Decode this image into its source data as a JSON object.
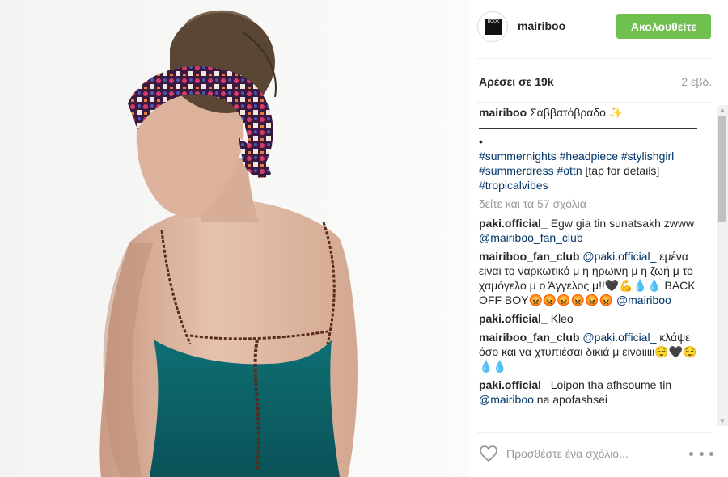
{
  "header": {
    "username": "mairiboo",
    "follow_label": "Ακολουθείτε"
  },
  "meta": {
    "likes": "Αρέσει σε 19k",
    "time": "2 εβδ."
  },
  "caption": {
    "user": "mairiboo",
    "text_line1": "Σαββατόβραδο ✨",
    "dashes": "————————————————————•",
    "hashtags_1": "#summernights #headpiece #stylishgirl",
    "hashtags_2": "#summerdress #ottn",
    "tail": " [tap for details]",
    "hashtags_3": "#tropicalvibes"
  },
  "view_all": "δείτε και τα 57 σχόλια",
  "comments": [
    {
      "user": "paki.official_",
      "text": " Egw gia tin sunatsakh zwww ",
      "tag": "@mairiboo_fan_club",
      "after": ""
    },
    {
      "user": "mairiboo_fan_club",
      "tag_pre": "@paki.official_",
      "text": " εμένα ειναι το ναρκωτικό μ η ηρωινη μ η ζωή μ το χαμόγελο μ ο Άγγελος μ!!🖤💪💧💧 BACK OFF BOY😡😡😡😡😡😡 ",
      "tag": "@mairiboo"
    },
    {
      "user": "paki.official_",
      "text": " Kleo"
    },
    {
      "user": "mairiboo_fan_club",
      "tag_pre": "@paki.official_",
      "text": " κλάψε όσο και να χτυπιέσαι δικιά μ ειναιιιιι😌🖤😌💧💧"
    },
    {
      "user": "paki.official_",
      "text": " Loipon tha afhsoume tin ",
      "tag": "@mairiboo",
      "after": " na apofashsei"
    }
  ],
  "footer": {
    "comment_placeholder": "Προσθέστε ένα σχόλιο..."
  },
  "colors": {
    "follow_green": "#70c050",
    "link_blue": "#003569",
    "muted_gray": "#999999"
  },
  "icons": {
    "heart": "heart-icon",
    "more": "more-options-icon",
    "avatar_logo": "brand-logo"
  },
  "avatar_logo_text": "BOOK"
}
